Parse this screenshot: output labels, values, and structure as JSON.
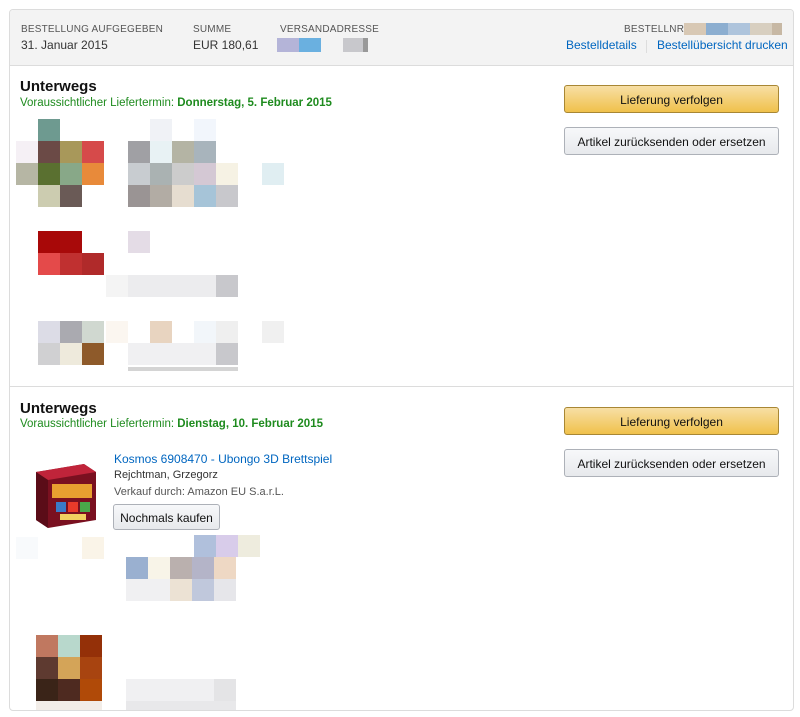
{
  "header": {
    "placed_label": "Bestellung aufgegeben",
    "placed_value": "31. Januar 2015",
    "total_label": "Summe",
    "total_value": "EUR 180,61",
    "address_label": "Versandadresse",
    "order_no_label": "Bestellnr.",
    "details_link": "Bestelldetails",
    "print_link": "Bestellübersicht drucken"
  },
  "shipments": [
    {
      "status": "Unterwegs",
      "eta_prefix": "Voraussichtlicher Liefertermin:",
      "eta_date": "Donnerstag, 5. Februar 2015",
      "track_label": "Lieferung verfolgen",
      "return_label": "Artikel zurücksenden oder ersetzen"
    },
    {
      "status": "Unterwegs",
      "eta_prefix": "Voraussichtlicher Liefertermin:",
      "eta_date": "Dienstag, 10. Februar 2015",
      "track_label": "Lieferung verfolgen",
      "return_label": "Artikel zurücksenden oder ersetzen",
      "item": {
        "title": "Kosmos 6908470 - Ubongo 3D Brettspiel",
        "author": "Rejchtman, Grzegorz",
        "seller": "Verkauf durch: Amazon EU S.a.r.L.",
        "buy_again_label": "Nochmals kaufen"
      }
    }
  ],
  "colors": {
    "link": "#0066c0",
    "eta_green": "#1e8b1e",
    "primary_button": "#f0c14b",
    "header_bg": "#f3f3f3"
  }
}
